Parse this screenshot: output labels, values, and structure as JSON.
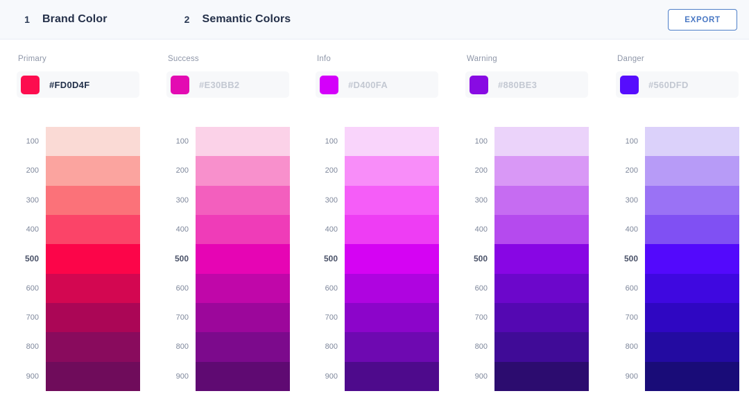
{
  "header": {
    "steps": [
      {
        "number": "1",
        "label": "Brand Color"
      },
      {
        "number": "2",
        "label": "Semantic Colors"
      }
    ],
    "export_label": "EXPORT"
  },
  "ticks": [
    "100",
    "200",
    "300",
    "400",
    "500",
    "600",
    "700",
    "800",
    "900"
  ],
  "bold_tick": "500",
  "columns": [
    {
      "label": "Primary",
      "hex_value": "#FD0D4F",
      "hex_placeholder": "",
      "is_placeholder": false,
      "chip_color": "#FD0D4F",
      "shades": [
        "#FADAD5",
        "#FBA49F",
        "#FB7279",
        "#FB4468",
        "#FC0549",
        "#D30751",
        "#AB0656",
        "#890B5D",
        "#6F0C5B"
      ]
    },
    {
      "label": "Success",
      "hex_value": "",
      "hex_placeholder": "#E30BB2",
      "is_placeholder": true,
      "chip_color": "#E30BB2",
      "shades": [
        "#FBD2E8",
        "#F890CC",
        "#F35FBE",
        "#EF3CB8",
        "#E605B4",
        "#C007A9",
        "#9C079B",
        "#7C0A8C",
        "#5F0A72"
      ]
    },
    {
      "label": "Info",
      "hex_value": "",
      "hex_placeholder": "#D400FA",
      "is_placeholder": true,
      "chip_color": "#D400FA",
      "shades": [
        "#F9D4FB",
        "#F88DF9",
        "#F55DF8",
        "#EE3DF4",
        "#D503F3",
        "#AF04E0",
        "#8C05CA",
        "#6E09B1",
        "#4E0A8C"
      ]
    },
    {
      "label": "Warning",
      "hex_value": "",
      "hex_placeholder": "#880BE3",
      "is_placeholder": true,
      "chip_color": "#880BE3",
      "shades": [
        "#EBD3FA",
        "#D998F6",
        "#C66CF2",
        "#B54AEE",
        "#8806E4",
        "#6C07CB",
        "#5408B2",
        "#400B97",
        "#2C0C6F"
      ]
    },
    {
      "label": "Danger",
      "hex_value": "",
      "hex_placeholder": "#560DFD",
      "is_placeholder": true,
      "chip_color": "#560DFD",
      "shades": [
        "#DBD1FA",
        "#B79BF7",
        "#9A72F5",
        "#8050F3",
        "#5309FC",
        "#3F08E0",
        "#2F07C2",
        "#230BA1",
        "#190C78"
      ]
    }
  ]
}
